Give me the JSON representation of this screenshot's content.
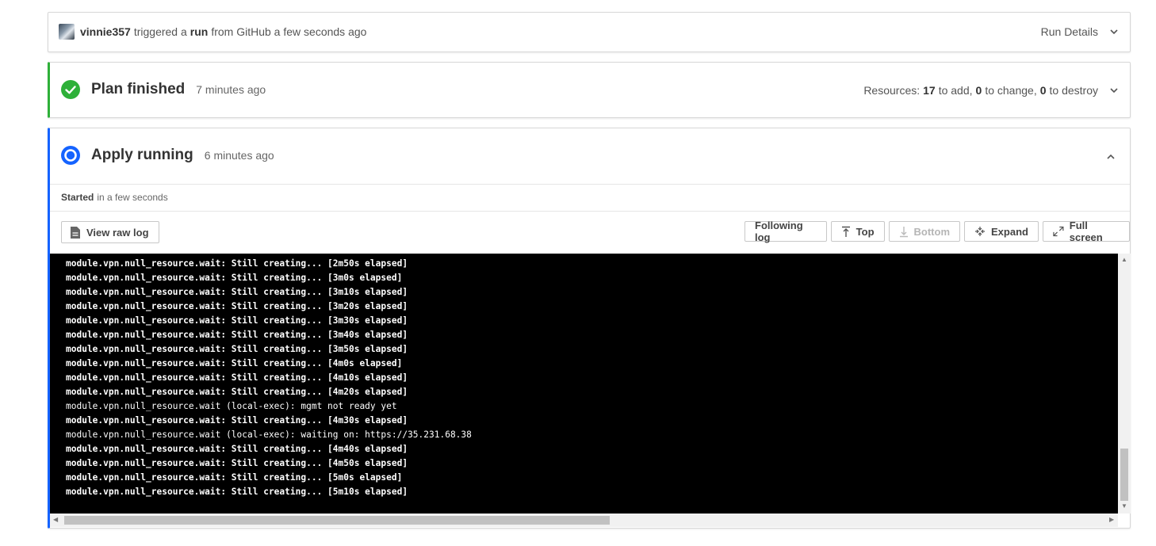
{
  "trigger": {
    "user": "vinnie357",
    "triggered_text": "triggered a",
    "run_word": "run",
    "source_text": "from GitHub a few seconds ago",
    "run_details": "Run Details"
  },
  "plan": {
    "title": "Plan finished",
    "ago": "7 minutes ago",
    "resources_label": "Resources:",
    "add_count": "17",
    "add_text": "to add,",
    "change_count": "0",
    "change_text": "to change,",
    "destroy_count": "0",
    "destroy_text": "to destroy",
    "status_color": "#2eb039"
  },
  "apply": {
    "title": "Apply running",
    "ago": "6 minutes ago",
    "started_label": "Started",
    "started_text": "in a few seconds",
    "status_color": "#1563ff"
  },
  "toolbar": {
    "view_raw_log": "View raw log",
    "following_log": "Following log",
    "top": "Top",
    "bottom": "Bottom",
    "expand": "Expand",
    "full_screen": "Full screen"
  },
  "log_lines": [
    {
      "text": "module.vpn.null_resource.wait: Still creating... [2m50s elapsed]",
      "bold": true
    },
    {
      "text": "module.vpn.null_resource.wait: Still creating... [3m0s elapsed]",
      "bold": true
    },
    {
      "text": "module.vpn.null_resource.wait: Still creating... [3m10s elapsed]",
      "bold": true
    },
    {
      "text": "module.vpn.null_resource.wait: Still creating... [3m20s elapsed]",
      "bold": true
    },
    {
      "text": "module.vpn.null_resource.wait: Still creating... [3m30s elapsed]",
      "bold": true
    },
    {
      "text": "module.vpn.null_resource.wait: Still creating... [3m40s elapsed]",
      "bold": true
    },
    {
      "text": "module.vpn.null_resource.wait: Still creating... [3m50s elapsed]",
      "bold": true
    },
    {
      "text": "module.vpn.null_resource.wait: Still creating... [4m0s elapsed]",
      "bold": true
    },
    {
      "text": "module.vpn.null_resource.wait: Still creating... [4m10s elapsed]",
      "bold": true
    },
    {
      "text": "module.vpn.null_resource.wait: Still creating... [4m20s elapsed]",
      "bold": true
    },
    {
      "text": "module.vpn.null_resource.wait (local-exec): mgmt not ready yet",
      "bold": false
    },
    {
      "text": "module.vpn.null_resource.wait: Still creating... [4m30s elapsed]",
      "bold": true
    },
    {
      "text": "module.vpn.null_resource.wait (local-exec): waiting on: https://35.231.68.38",
      "bold": false
    },
    {
      "text": "module.vpn.null_resource.wait: Still creating... [4m40s elapsed]",
      "bold": true
    },
    {
      "text": "module.vpn.null_resource.wait: Still creating... [4m50s elapsed]",
      "bold": true
    },
    {
      "text": "module.vpn.null_resource.wait: Still creating... [5m0s elapsed]",
      "bold": true
    },
    {
      "text": "module.vpn.null_resource.wait: Still creating... [5m10s elapsed]",
      "bold": true
    }
  ]
}
